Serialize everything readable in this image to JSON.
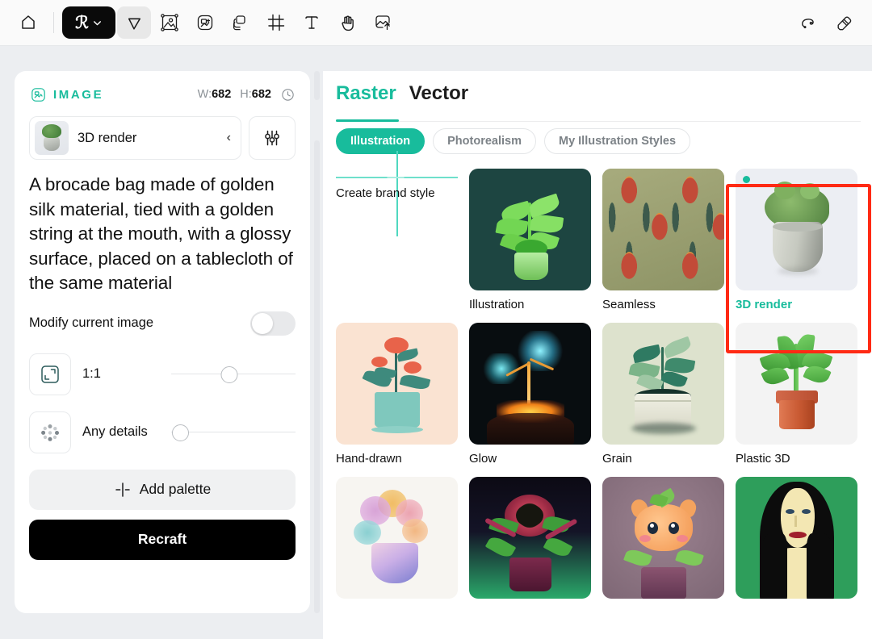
{
  "toolbar": {
    "items": [
      {
        "name": "home-icon",
        "label": "Home"
      },
      {
        "name": "recraft-logo",
        "label": "Recraft"
      },
      {
        "name": "select-cursor-icon",
        "label": "Select"
      },
      {
        "name": "image-frame-icon",
        "label": "Image"
      },
      {
        "name": "generate-image-icon",
        "label": "Generate"
      },
      {
        "name": "layers-icon",
        "label": "Layers"
      },
      {
        "name": "crop-frame-icon",
        "label": "Frame"
      },
      {
        "name": "text-icon",
        "label": "Text"
      },
      {
        "name": "hand-icon",
        "label": "Pan"
      },
      {
        "name": "upload-image-icon",
        "label": "Upload"
      },
      {
        "name": "lasso-scribble-icon",
        "label": "Scribble"
      },
      {
        "name": "eraser-icon",
        "label": "Eraser"
      }
    ]
  },
  "left_panel": {
    "section_title": "IMAGE",
    "width_label": "W:",
    "width_value": "682",
    "height_label": "H:",
    "height_value": "682",
    "history_icon": "clock-icon",
    "style_selector": {
      "name": "3D render",
      "chevron": "‹"
    },
    "settings_button": "sliders-icon",
    "prompt": "A brocade bag made of golden silk material, tied with a golden string at the mouth, with a glossy surface, placed on a tablecloth of the same material",
    "modify_toggle": {
      "label": "Modify current image",
      "state": "off"
    },
    "aspect": {
      "icon": "aspect-ratio-icon",
      "label": "1:1",
      "slider_percent": 47
    },
    "details": {
      "icon": "details-dots-icon",
      "label": "Any details",
      "slider_percent": 0
    },
    "add_palette_label": "Add palette",
    "add_palette_icon": "plus-icon",
    "recraft_label": "Recraft"
  },
  "right_panel": {
    "tabs": [
      {
        "label": "Raster",
        "active": true
      },
      {
        "label": "Vector",
        "active": false
      }
    ],
    "chips": [
      {
        "label": "Illustration",
        "active": true
      },
      {
        "label": "Photorealism",
        "active": false
      },
      {
        "label": "My Illustration Styles",
        "active": false
      }
    ],
    "brand_tile_label": "Create brand style",
    "styles": [
      {
        "label": "Illustration",
        "selected": false,
        "art": "illustration"
      },
      {
        "label": "Seamless",
        "selected": false,
        "art": "seamless"
      },
      {
        "label": "3D render",
        "selected": true,
        "art": "render3d"
      },
      {
        "label": "Hand-drawn",
        "selected": false,
        "art": "handdrawn"
      },
      {
        "label": "Glow",
        "selected": false,
        "art": "glow"
      },
      {
        "label": "Grain",
        "selected": false,
        "art": "grain"
      },
      {
        "label": "Plastic 3D",
        "selected": false,
        "art": "plastic3d"
      },
      {
        "label": "",
        "selected": false,
        "art": "watercolor"
      },
      {
        "label": "",
        "selected": false,
        "art": "horror"
      },
      {
        "label": "",
        "selected": false,
        "art": "kawaii"
      },
      {
        "label": "",
        "selected": false,
        "art": "portrait"
      }
    ]
  },
  "colors": {
    "accent": "#18bc9c",
    "highlight": "#ff2a14",
    "text": "#111111",
    "muted": "#7c8287",
    "panel_bg": "#ffffff",
    "app_bg": "#eceef1"
  }
}
